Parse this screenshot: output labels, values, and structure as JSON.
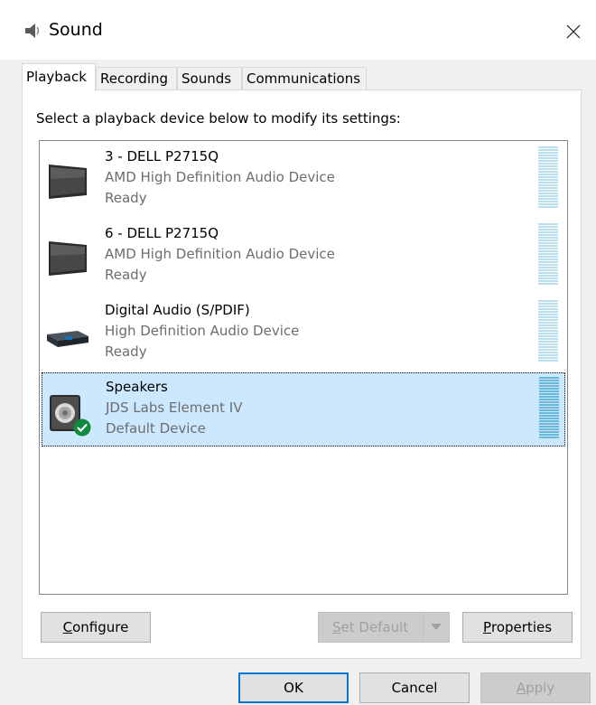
{
  "window": {
    "title": "Sound",
    "close_glyph": "✕"
  },
  "tabs": [
    {
      "label": "Playback",
      "active": true
    },
    {
      "label": "Recording",
      "active": false
    },
    {
      "label": "Sounds",
      "active": false
    },
    {
      "label": "Communications",
      "active": false
    }
  ],
  "playback": {
    "instruction": "Select a playback device below to modify its settings:",
    "devices": [
      {
        "name": "3 - DELL P2715Q",
        "driver": "AMD High Definition Audio Device",
        "status": "Ready",
        "icon": "monitor-icon",
        "selected": false
      },
      {
        "name": "6 - DELL P2715Q",
        "driver": "AMD High Definition Audio Device",
        "status": "Ready",
        "icon": "monitor-icon",
        "selected": false
      },
      {
        "name": "Digital Audio (S/PDIF)",
        "driver": "High Definition Audio Device",
        "status": "Ready",
        "icon": "spdif-icon",
        "selected": false
      },
      {
        "name": "Speakers",
        "driver": "JDS Labs Element IV",
        "status": "Default Device",
        "icon": "speaker-icon",
        "selected": true,
        "default": true
      }
    ],
    "buttons": {
      "configure": {
        "prefix": "",
        "mnemonic": "C",
        "rest": "onfigure"
      },
      "set_default": {
        "prefix": "",
        "mnemonic": "S",
        "rest": "et Default"
      },
      "properties": {
        "prefix": "",
        "mnemonic": "P",
        "rest": "roperties"
      }
    }
  },
  "footer": {
    "ok": "OK",
    "cancel": "Cancel",
    "apply": {
      "mnemonic": "A",
      "rest": "pply"
    }
  },
  "colors": {
    "selection": "#cce8ff",
    "accent": "#0078d7",
    "default_check": "#10893e"
  }
}
